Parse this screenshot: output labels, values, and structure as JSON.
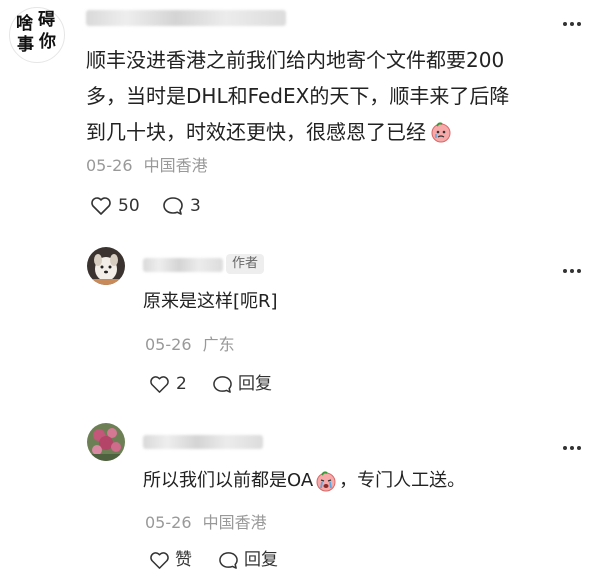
{
  "comment": {
    "avatar_chars": [
      "啥",
      "事",
      "碍",
      "你"
    ],
    "text_line1": "顺丰没进香港之前我们给内地寄个文件都要200",
    "text_line2": "多，当时是DHL和FedEX的天下，顺丰来了后降",
    "text_line3": "到几十块，时效还更快，很感恩了已经",
    "date": "05-26",
    "location": "中国香港",
    "likes": "50",
    "replies": "3",
    "more_icon": "more-dots-icon",
    "like_icon": "heart-icon",
    "comment_icon": "comment-bubble-icon"
  },
  "replies": [
    {
      "author_tag": "作者",
      "text": "原来是这样[呃R]",
      "date": "05-26",
      "location": "广东",
      "likes": "2",
      "reply_label": "回复"
    },
    {
      "text_before": "所以我们以前都是OA",
      "text_after": "，专门人工送。",
      "date": "05-26",
      "location": "中国香港",
      "like_label": "赞",
      "reply_label": "回复"
    }
  ],
  "colors": {
    "text": "#222222",
    "meta": "#999999",
    "tag_bg": "#eeeeee",
    "emoji_face": "#f7a8a8"
  }
}
